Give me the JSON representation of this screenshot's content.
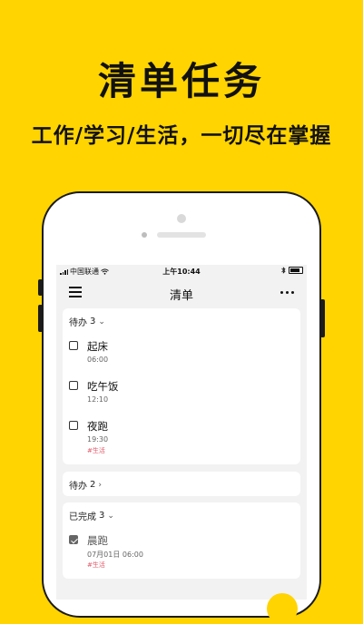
{
  "promo": {
    "title": "清单任务",
    "subtitle": "工作/学习/生活，一切尽在掌握"
  },
  "status_bar": {
    "carrier": "中国联通",
    "time": "上午10:44"
  },
  "nav": {
    "title": "清单",
    "menu_icon": "hamburger-icon",
    "more_icon": "more-dots-icon"
  },
  "sections": {
    "todo": {
      "label": "待办",
      "count": "3",
      "tasks": [
        {
          "title": "起床",
          "time": "06:00",
          "tag": ""
        },
        {
          "title": "吃午饭",
          "time": "12:10",
          "tag": ""
        },
        {
          "title": "夜跑",
          "time": "19:30",
          "tag": "#生活"
        }
      ]
    },
    "todo_collapsed": {
      "label": "待办",
      "count": "2"
    },
    "done": {
      "label": "已完成",
      "count": "3",
      "tasks": [
        {
          "title": "晨跑",
          "time": "07月01日 06:00",
          "tag": "#生活",
          "checked": true
        }
      ]
    }
  },
  "colors": {
    "background": "#FFD400",
    "tag": "#e05a6a"
  }
}
